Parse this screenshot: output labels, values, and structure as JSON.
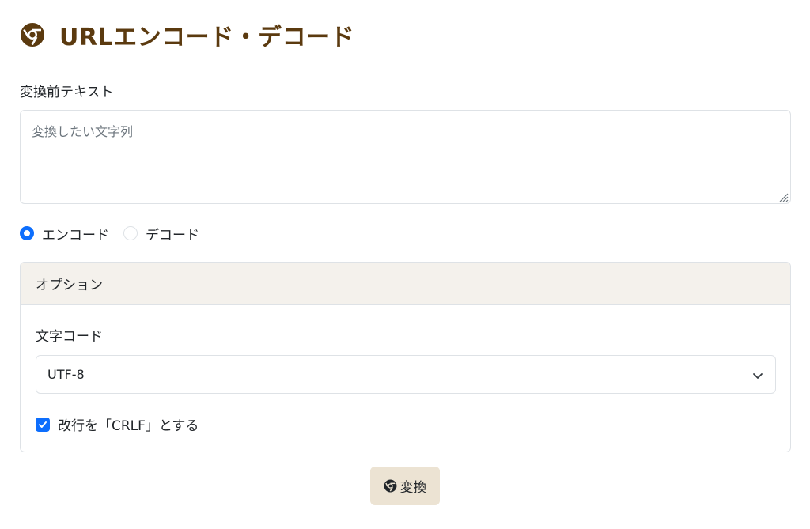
{
  "header": {
    "title": "URLエンコード・デコード",
    "icon": "aperture-icon",
    "title_color": "#5b3a0f"
  },
  "input": {
    "label": "変換前テキスト",
    "placeholder": "変換したい文字列",
    "value": ""
  },
  "mode": {
    "options": [
      {
        "label": "エンコード",
        "checked": true
      },
      {
        "label": "デコード",
        "checked": false
      }
    ]
  },
  "options_card": {
    "header": "オプション",
    "charset_label": "文字コード",
    "charset_value": "UTF-8",
    "crlf_label": "改行を「CRLF」とする",
    "crlf_checked": true
  },
  "actions": {
    "convert_label": "変換",
    "convert_icon": "aperture-icon",
    "button_bg": "#ece3d3"
  },
  "colors": {
    "accent": "#0d6efd",
    "card_header_bg": "#f4f1ec"
  }
}
